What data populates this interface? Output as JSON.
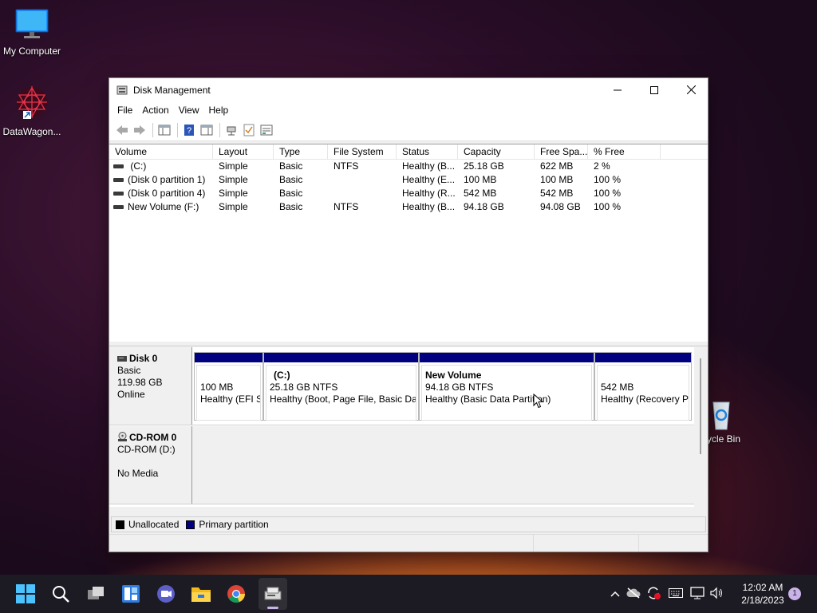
{
  "desktop": {
    "icons": [
      {
        "label": "My Computer"
      },
      {
        "label": "DataWagon..."
      },
      {
        "label": "ycle Bin"
      }
    ]
  },
  "window": {
    "title": "Disk Management",
    "menu": [
      "File",
      "Action",
      "View",
      "Help"
    ],
    "columns": [
      "Volume",
      "Layout",
      "Type",
      "File System",
      "Status",
      "Capacity",
      "Free Spa...",
      "% Free"
    ],
    "volumes": [
      {
        "volume": " (C:)",
        "layout": "Simple",
        "type": "Basic",
        "fs": "NTFS",
        "status": "Healthy (B...",
        "capacity": "25.18 GB",
        "free": "622 MB",
        "pct": "2 %"
      },
      {
        "volume": "(Disk 0 partition 1)",
        "layout": "Simple",
        "type": "Basic",
        "fs": "",
        "status": "Healthy (E...",
        "capacity": "100 MB",
        "free": "100 MB",
        "pct": "100 %"
      },
      {
        "volume": "(Disk 0 partition 4)",
        "layout": "Simple",
        "type": "Basic",
        "fs": "",
        "status": "Healthy (R...",
        "capacity": "542 MB",
        "free": "542 MB",
        "pct": "100 %"
      },
      {
        "volume": "New Volume (F:)",
        "layout": "Simple",
        "type": "Basic",
        "fs": "NTFS",
        "status": "Healthy (B...",
        "capacity": "94.18 GB",
        "free": "94.08 GB",
        "pct": "100 %"
      }
    ],
    "disks": {
      "disk0": {
        "name": "Disk 0",
        "type": "Basic",
        "size": "119.98 GB",
        "state": "Online",
        "partitions": [
          {
            "name": "",
            "size": "100 MB",
            "status": "Healthy (EFI S"
          },
          {
            "name": "(C:)",
            "size": "25.18 GB NTFS",
            "status": "Healthy (Boot, Page File, Basic Dat"
          },
          {
            "name": "New Volume",
            "size": "94.18 GB NTFS",
            "status": "Healthy (Basic Data Partition)"
          },
          {
            "name": "",
            "size": "542 MB",
            "status": "Healthy (Recovery P"
          }
        ]
      },
      "cdrom": {
        "name": "CD-ROM 0",
        "drive": "CD-ROM (D:)",
        "media": "No Media"
      }
    },
    "legend": {
      "unallocated": "Unallocated",
      "primary": "Primary partition",
      "unallocated_color": "#000000",
      "primary_color": "#000080"
    }
  },
  "taskbar": {
    "time": "12:02 AM",
    "date": "2/18/2023",
    "notification_count": "1"
  }
}
